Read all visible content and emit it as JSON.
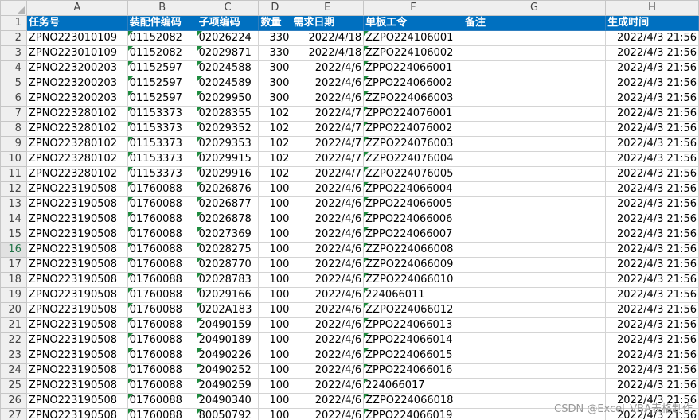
{
  "columns": [
    "A",
    "B",
    "C",
    "D",
    "E",
    "F",
    "G",
    "H"
  ],
  "headers": [
    "任务号",
    "装配件编码",
    "子项编码",
    "数量",
    "需求日期",
    "单板工令",
    "备注",
    "生成时间"
  ],
  "active_row": 16,
  "rows": [
    [
      "ZPNO223010109",
      "01152082",
      "02026224",
      "330",
      "2022/4/18",
      "ZZPO224106001",
      "",
      "2022/4/3 21:56"
    ],
    [
      "ZPNO223010109",
      "01152082",
      "02029871",
      "330",
      "2022/4/18",
      "ZZPO224106002",
      "",
      "2022/4/3 21:56"
    ],
    [
      "ZPNO223200203",
      "01152597",
      "02024588",
      "300",
      "2022/4/6",
      "ZPPO224066001",
      "",
      "2022/4/3 21:56"
    ],
    [
      "ZPNO223200203",
      "01152597",
      "02024589",
      "300",
      "2022/4/6",
      "ZPPO224066002",
      "",
      "2022/4/3 21:56"
    ],
    [
      "ZPNO223200203",
      "01152597",
      "02029950",
      "300",
      "2022/4/6",
      "ZZPO224066003",
      "",
      "2022/4/3 21:56"
    ],
    [
      "ZPNO223280102",
      "01153373",
      "02028355",
      "102",
      "2022/4/7",
      "ZPPO224076001",
      "",
      "2022/4/3 21:56"
    ],
    [
      "ZPNO223280102",
      "01153373",
      "02029352",
      "102",
      "2022/4/7",
      "ZPPO224076002",
      "",
      "2022/4/3 21:56"
    ],
    [
      "ZPNO223280102",
      "01153373",
      "02029353",
      "102",
      "2022/4/7",
      "ZZPO224076003",
      "",
      "2022/4/3 21:56"
    ],
    [
      "ZPNO223280102",
      "01153373",
      "02029915",
      "102",
      "2022/4/7",
      "ZZPO224076004",
      "",
      "2022/4/3 21:56"
    ],
    [
      "ZPNO223280102",
      "01153373",
      "02029916",
      "102",
      "2022/4/7",
      "ZZPO224076005",
      "",
      "2022/4/3 21:56"
    ],
    [
      "ZPNO223190508",
      "01760088",
      "02026876",
      "100",
      "2022/4/6",
      "ZPPO224066004",
      "",
      "2022/4/3 21:56"
    ],
    [
      "ZPNO223190508",
      "01760088",
      "02026877",
      "100",
      "2022/4/6",
      "ZPPO224066005",
      "",
      "2022/4/3 21:56"
    ],
    [
      "ZPNO223190508",
      "01760088",
      "02026878",
      "100",
      "2022/4/6",
      "ZPPO224066006",
      "",
      "2022/4/3 21:56"
    ],
    [
      "ZPNO223190508",
      "01760088",
      "02027369",
      "100",
      "2022/4/6",
      "ZPPO224066007",
      "",
      "2022/4/3 21:56"
    ],
    [
      "ZPNO223190508",
      "01760088",
      "02028275",
      "100",
      "2022/4/6",
      "ZZPO224066008",
      "",
      "2022/4/3 21:56"
    ],
    [
      "ZPNO223190508",
      "01760088",
      "02028770",
      "100",
      "2022/4/6",
      "ZZPO224066009",
      "",
      "2022/4/3 21:56"
    ],
    [
      "ZPNO223190508",
      "01760088",
      "02028783",
      "100",
      "2022/4/6",
      "ZZPO224066010",
      "",
      "2022/4/3 21:56"
    ],
    [
      "ZPNO223190508",
      "01760088",
      "02029166",
      "100",
      "2022/4/6",
      "224066011",
      "",
      "2022/4/3 21:56"
    ],
    [
      "ZPNO223190508",
      "01760088",
      "0202A183",
      "100",
      "2022/4/6",
      "ZZPO224066012",
      "",
      "2022/4/3 21:56"
    ],
    [
      "ZPNO223190508",
      "01760088",
      "20490159",
      "100",
      "2022/4/6",
      "ZPPO224066013",
      "",
      "2022/4/3 21:56"
    ],
    [
      "ZPNO223190508",
      "01760088",
      "20490189",
      "100",
      "2022/4/6",
      "ZPPO224066014",
      "",
      "2022/4/3 21:56"
    ],
    [
      "ZPNO223190508",
      "01760088",
      "20490226",
      "100",
      "2022/4/6",
      "ZPPO224066015",
      "",
      "2022/4/3 21:56"
    ],
    [
      "ZPNO223190508",
      "01760088",
      "20490252",
      "100",
      "2022/4/6",
      "ZPPO224066016",
      "",
      "2022/4/3 21:56"
    ],
    [
      "ZPNO223190508",
      "01760088",
      "20490259",
      "100",
      "2022/4/6",
      "224066017",
      "",
      "2022/4/3 21:56"
    ],
    [
      "ZPNO223190508",
      "01760088",
      "20490340",
      "100",
      "2022/4/6",
      "ZZPO224066018",
      "",
      "2022/4/3 21:56"
    ],
    [
      "ZPNO223190508",
      "01760088",
      "80050792",
      "100",
      "2022/4/6",
      "ZPPO224066019",
      "",
      "2022/4/3 21:56"
    ]
  ],
  "watermark": "CSDN @Excel_VBA表格制作",
  "colors": {
    "header_fill": "#0070c0",
    "header_text": "#ffffff",
    "error_flag": "#1e8b3e",
    "active_row_label": "#217346"
  }
}
